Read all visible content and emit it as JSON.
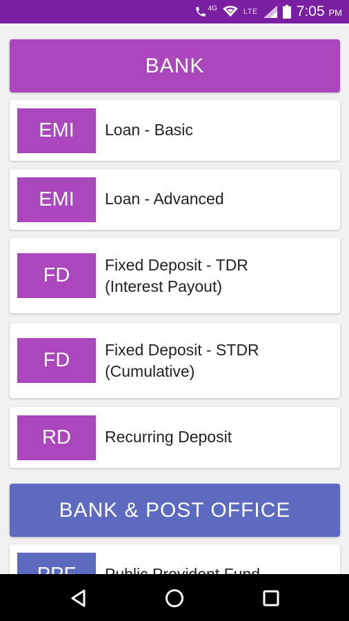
{
  "status_bar": {
    "network_4g": "4G",
    "lte": "LTE",
    "time": "7:05",
    "ampm": "PM"
  },
  "colors": {
    "status_bar": "#7b1fa2",
    "bank_accent": "#ab47bc",
    "post_office_accent": "#5c6bc0"
  },
  "sections": [
    {
      "header": "BANK",
      "items": [
        {
          "badge": "EMI",
          "label": "Loan - Basic"
        },
        {
          "badge": "EMI",
          "label": "Loan - Advanced"
        },
        {
          "badge": "FD",
          "label": "Fixed Deposit - TDR\n(Interest Payout)"
        },
        {
          "badge": "FD",
          "label": "Fixed Deposit - STDR\n(Cumulative)"
        },
        {
          "badge": "RD",
          "label": "Recurring Deposit"
        }
      ]
    },
    {
      "header": "BANK & POST OFFICE",
      "items": [
        {
          "badge": "PPF",
          "label": "Public Provident Fund"
        }
      ]
    }
  ],
  "nav_bar": {
    "icons": [
      "back-icon",
      "home-icon",
      "recents-icon"
    ]
  }
}
